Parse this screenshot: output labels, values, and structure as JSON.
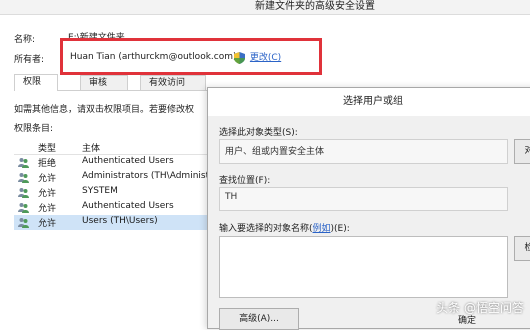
{
  "window": {
    "title": "新建文件夹的高级安全设置"
  },
  "info": {
    "name_label": "名称:",
    "name_value": "E:\\新建文件夹",
    "owner_label": "所有者:",
    "owner_value": "Huan Tian (arthurckm@outlook.com)",
    "change_link": "更改(C)"
  },
  "tabs": [
    {
      "label": "权限"
    },
    {
      "label": "审核"
    },
    {
      "label": "有效访问"
    }
  ],
  "permissions": {
    "hint": "如需其他信息，请双击权限项目。若要修改权",
    "entries_label": "权限条目:",
    "columns": [
      "类型",
      "主体"
    ],
    "rows": [
      {
        "type": "拒绝",
        "principal": "Authenticated Users"
      },
      {
        "type": "允许",
        "principal": "Administrators (TH\\Administr"
      },
      {
        "type": "允许",
        "principal": "SYSTEM"
      },
      {
        "type": "允许",
        "principal": "Authenticated Users"
      },
      {
        "type": "允许",
        "principal": "Users (TH\\Users)"
      }
    ]
  },
  "dialog": {
    "title": "选择用户或组",
    "object_type_label": "选择此对象类型(S):",
    "object_type_value": "用户、组或内置安全主体",
    "object_type_button": "对",
    "location_label": "查找位置(F):",
    "location_value": "TH",
    "names_label_prefix": "输入要选择的对象名称(",
    "names_example_link": "例如",
    "names_label_suffix": ")(E):",
    "check_button": "检",
    "advanced_button": "高级(A)...",
    "ok_button": "确定"
  },
  "watermark": "头条 @悟空问答"
}
